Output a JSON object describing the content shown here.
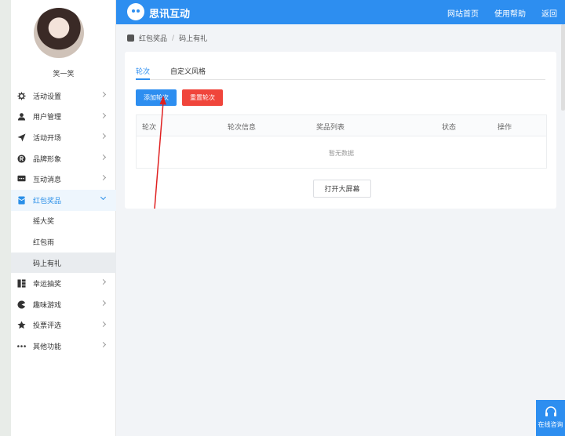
{
  "sidebar": {
    "username": "笑一笑",
    "items": [
      {
        "label": "活动设置",
        "icon": "gear-icon"
      },
      {
        "label": "用户管理",
        "icon": "user-icon"
      },
      {
        "label": "活动开场",
        "icon": "paper-plane-icon"
      },
      {
        "label": "品牌形象",
        "icon": "registered-icon"
      },
      {
        "label": "互动消息",
        "icon": "chat-icon"
      },
      {
        "label": "红包奖品",
        "icon": "red-packet-icon"
      },
      {
        "label": "幸运抽奖",
        "icon": "grid-icon"
      },
      {
        "label": "趣味游戏",
        "icon": "game-icon"
      },
      {
        "label": "投票评选",
        "icon": "star-icon"
      },
      {
        "label": "其他功能",
        "icon": "more-icon"
      }
    ],
    "subitems": [
      "摇大奖",
      "红包雨",
      "码上有礼"
    ]
  },
  "header": {
    "brand": "思讯互动",
    "nav": [
      "网站首页",
      "使用帮助",
      "返回"
    ]
  },
  "breadcrumb": [
    "红包奖品",
    "/",
    "码上有礼"
  ],
  "main": {
    "tabs": [
      "轮次",
      "自定义风格"
    ],
    "add_button": "添加轮次",
    "reset_button": "重置轮次",
    "columns": [
      "轮次",
      "轮次信息",
      "奖品列表",
      "状态",
      "操作"
    ],
    "empty_text": "暂无数据",
    "bigscreen_button": "打开大屏幕"
  },
  "consult": {
    "label": "在线咨询"
  },
  "colors": {
    "primary": "#2d8ef0",
    "danger": "#f0453b"
  }
}
